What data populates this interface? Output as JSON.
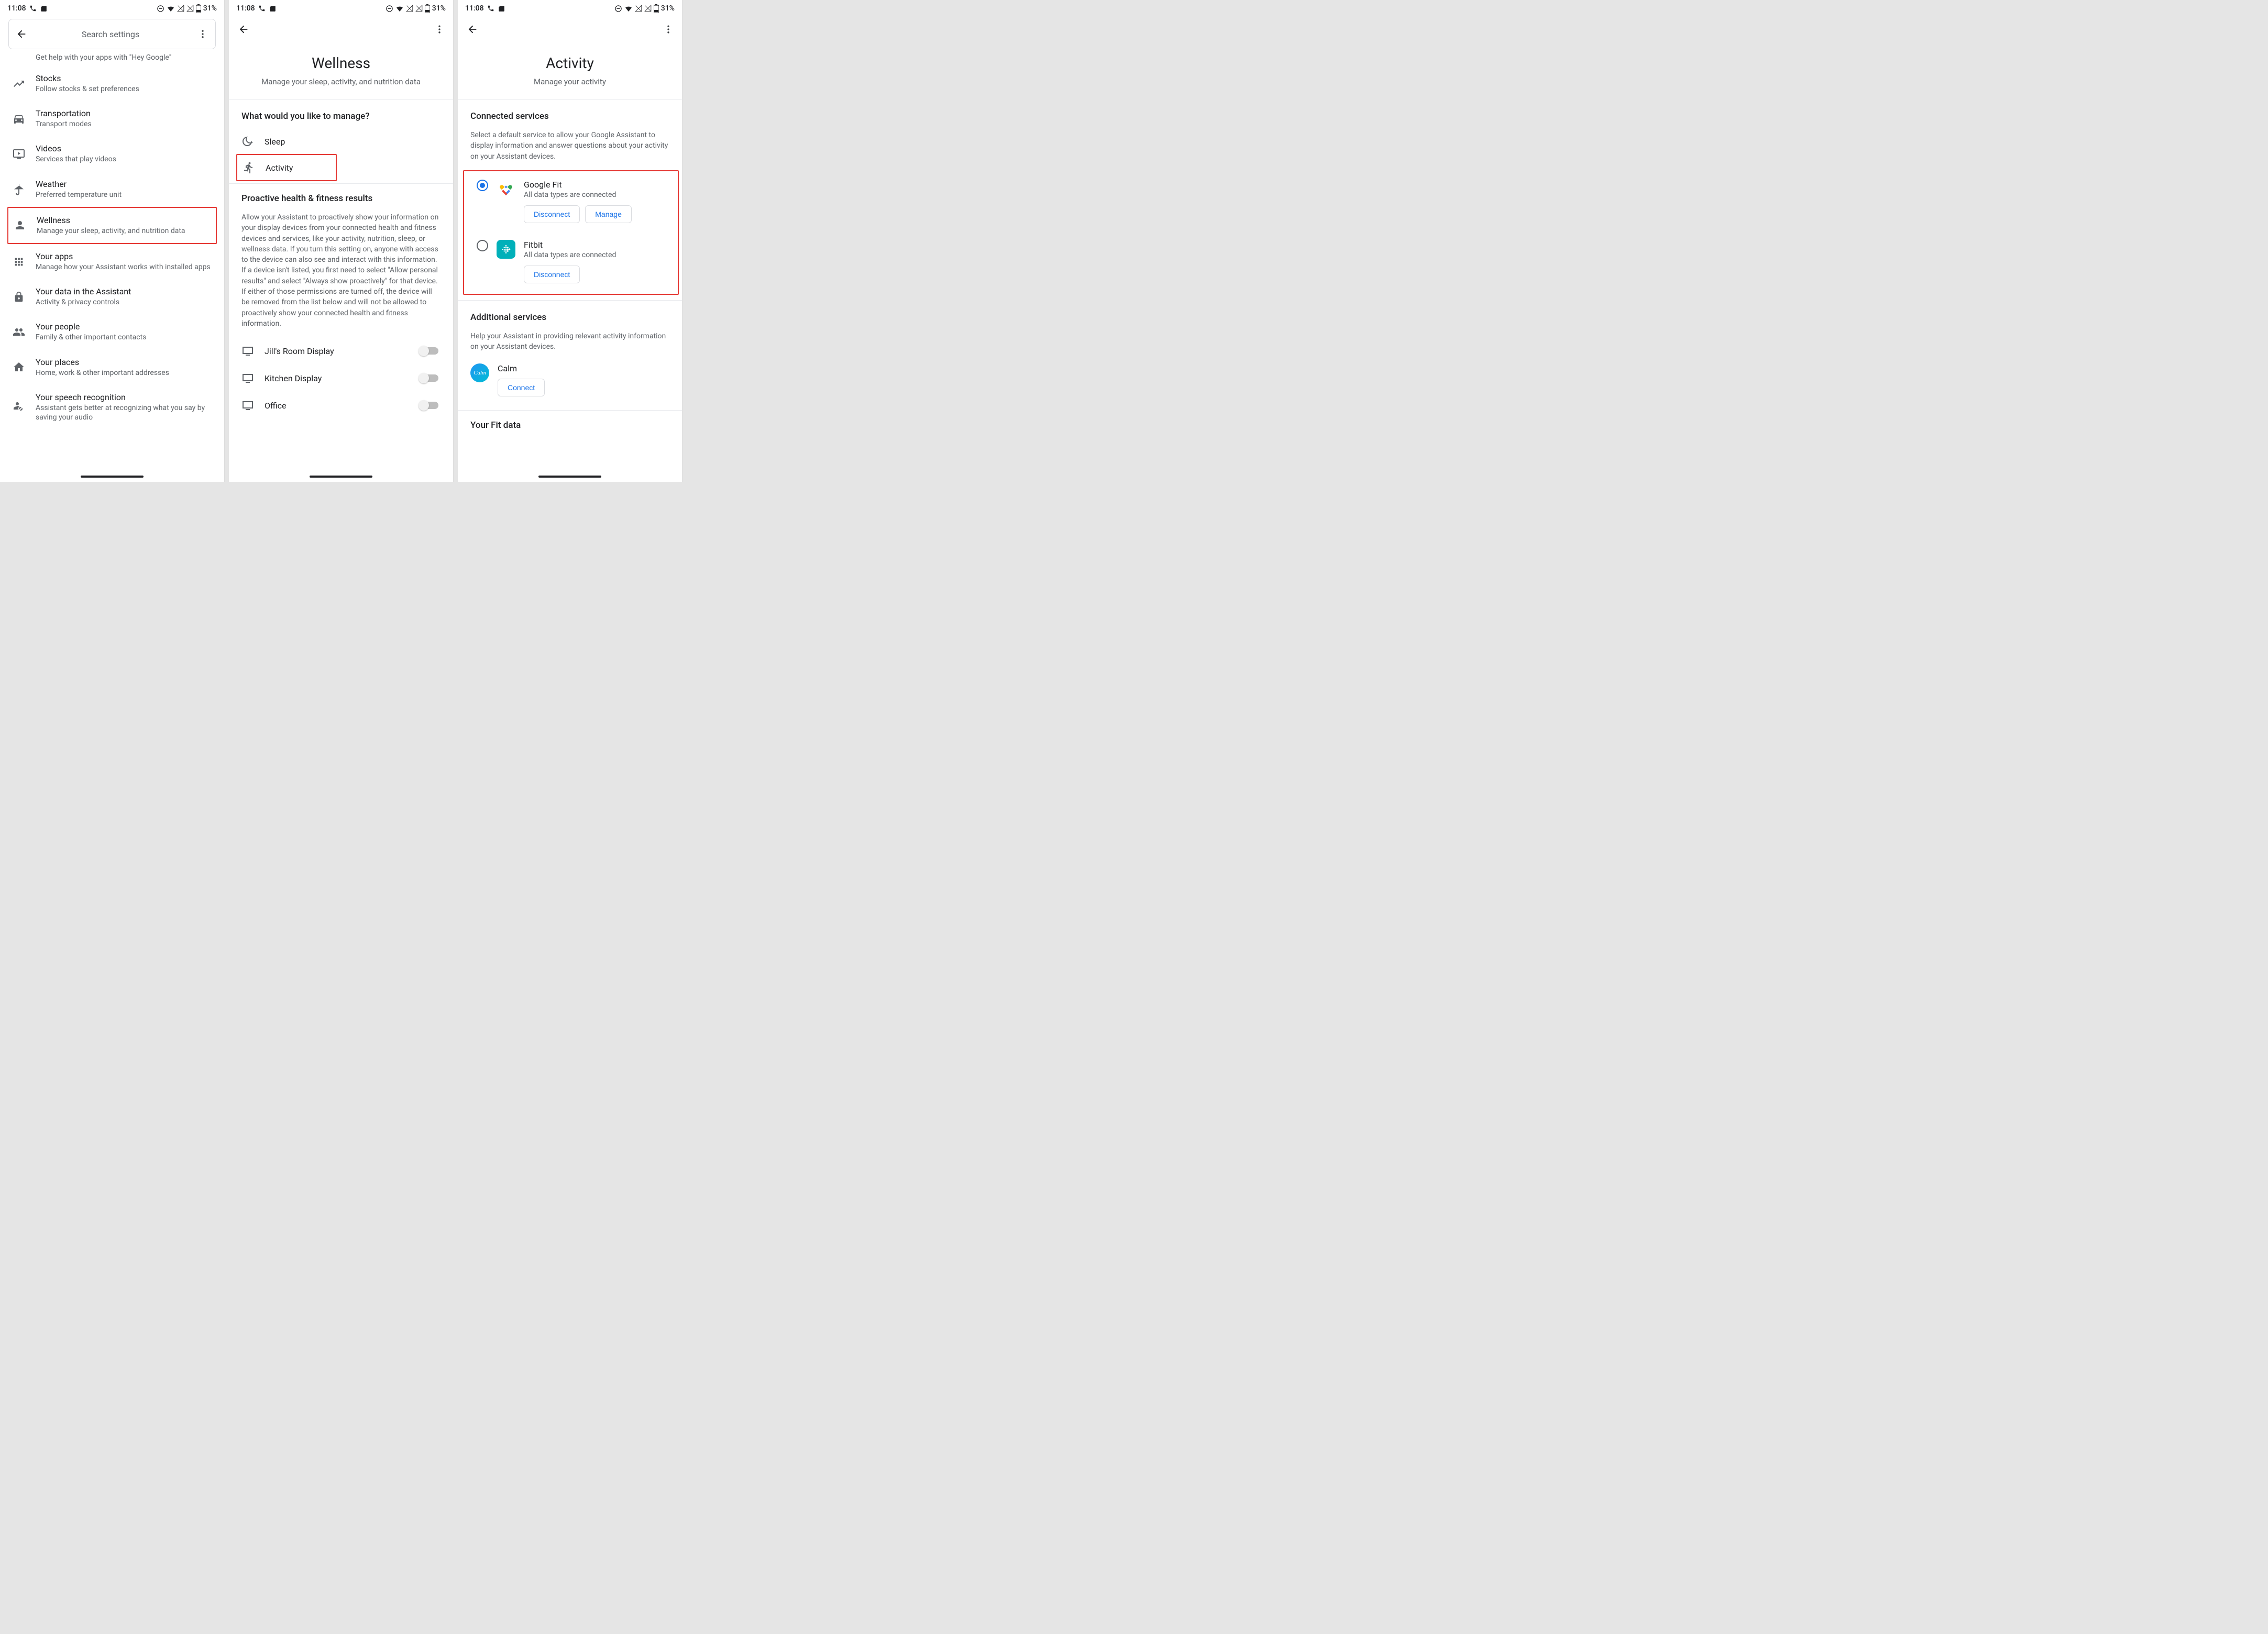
{
  "status": {
    "time": "11:08",
    "battery": "31%"
  },
  "screen1": {
    "search_placeholder": "Search settings",
    "partial_top": "Get help with your apps with \"Hey Google\"",
    "items": [
      {
        "title": "Stocks",
        "sub": "Follow stocks & set preferences"
      },
      {
        "title": "Transportation",
        "sub": "Transport modes"
      },
      {
        "title": "Videos",
        "sub": "Services that play videos"
      },
      {
        "title": "Weather",
        "sub": "Preferred temperature unit"
      },
      {
        "title": "Wellness",
        "sub": "Manage your sleep, activity, and nutrition data"
      },
      {
        "title": "Your apps",
        "sub": "Manage how your Assistant works with installed apps"
      },
      {
        "title": "Your data in the Assistant",
        "sub": "Activity & privacy controls"
      },
      {
        "title": "Your people",
        "sub": "Family & other important contacts"
      },
      {
        "title": "Your places",
        "sub": "Home, work & other important addresses"
      },
      {
        "title": "Your speech recognition",
        "sub": "Assistant gets better at recognizing what you say by saving your audio"
      }
    ]
  },
  "screen2": {
    "title": "Wellness",
    "subtitle": "Manage your sleep, activity, and nutrition data",
    "manage_heading": "What would you like to manage?",
    "options": [
      {
        "label": "Sleep"
      },
      {
        "label": "Activity"
      }
    ],
    "proactive_heading": "Proactive health & fitness results",
    "proactive_body": "Allow your Assistant to proactively show your information on your display devices from your connected health and fitness devices and services, like your activity, nutrition, sleep, or wellness data. If you turn this setting on, anyone with access to the device can also see and interact with this information. If a device isn't listed, you first need to select \"Allow personal results\" and select \"Always show proactively\" for that device. If either of those permissions are turned off, the device will be removed from the list below and will not be allowed to proactively show your connected health and fitness information.",
    "devices": [
      {
        "label": "Jill's Room Display"
      },
      {
        "label": "Kitchen Display"
      },
      {
        "label": "Office"
      }
    ]
  },
  "screen3": {
    "title": "Activity",
    "subtitle": "Manage your activity",
    "connected_heading": "Connected services",
    "connected_desc": "Select a default service to allow your Google Assistant to display information and answer questions about your activity on your Assistant devices.",
    "services": [
      {
        "name": "Google Fit",
        "sub": "All data types are connected",
        "btn1": "Disconnect",
        "btn2": "Manage"
      },
      {
        "name": "Fitbit",
        "sub": "All data types are connected",
        "btn1": "Disconnect"
      }
    ],
    "additional_heading": "Additional services",
    "additional_desc": "Help your Assistant in providing relevant activity information on your Assistant devices.",
    "additional": [
      {
        "name": "Calm",
        "btn": "Connect"
      }
    ],
    "fit_heading": "Your Fit data"
  }
}
